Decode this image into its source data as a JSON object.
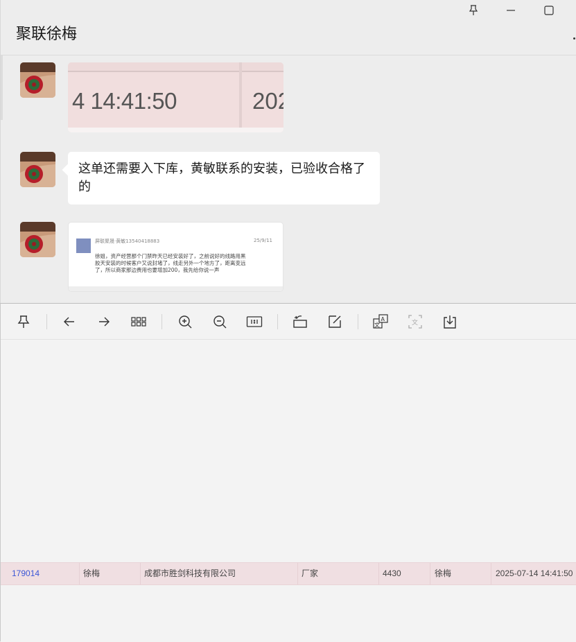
{
  "chat": {
    "title": "聚联徐梅",
    "image1": {
      "text_left": "4 14:41:50",
      "text_right": "202"
    },
    "text_message": "这单还需要入下库，黄敏联系的安装，已验收合格了的",
    "image2": {
      "sender": "屏联聚晟·黄敏13540418883",
      "date": "25/9/11",
      "body": "徐姐，资产经营那个门禁昨天已经安装好了，之前说好的线路用黑胶天安装的时候客户又说封堵了，线走另外一个地方了，距离变远了，所以商家那边费用也要增加200，我先给你说一声"
    }
  },
  "window_controls": {
    "pin": "pin-icon",
    "minimize": "minimize-icon",
    "maximize": "maximize-icon"
  },
  "toolbar_icons": [
    "pin-icon",
    "back-arrow-icon",
    "forward-arrow-icon",
    "grid-icon",
    "zoom-in-icon",
    "zoom-out-icon",
    "actual-size-icon",
    "rotate-icon",
    "edit-icon",
    "translate-icon",
    "extract-text-icon",
    "download-icon"
  ],
  "table_row": {
    "id": "179014",
    "user": "徐梅",
    "company": "成都市胜剑科技有限公司",
    "type": "厂家",
    "amount": "4430",
    "user2": "徐梅",
    "datetime": "2025-07-14 14:41:50"
  }
}
